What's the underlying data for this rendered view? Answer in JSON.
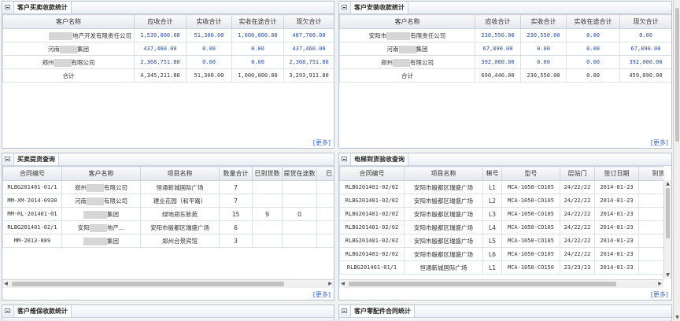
{
  "more_label": "[更多]",
  "sales_stats": {
    "title": "客户买卖收款统计",
    "headers": [
      "客户名称",
      "应收合计",
      "实收合计",
      "实收在途合计",
      "现欠合计"
    ],
    "rows": [
      {
        "name_suffix": "地产开发有限责任公司",
        "receivable": "1,539,000.00",
        "received": "51,300.00",
        "in_transit": "1,000,000.00",
        "owed": "487,700.00"
      },
      {
        "name_prefix": "河南",
        "name_suffix": "集团",
        "receivable": "437,460.00",
        "received": "0.00",
        "in_transit": "0.00",
        "owed": "437,460.00"
      },
      {
        "name_prefix": "郑州",
        "name_suffix": "有限公司",
        "receivable": "2,368,751.80",
        "received": "0.00",
        "in_transit": "0.00",
        "owed": "2,368,751.80"
      }
    ],
    "total": {
      "label": "合计",
      "receivable": "4,345,211.80",
      "received": "51,300.00",
      "in_transit": "1,000,000.00",
      "owed": "3,293,911.80"
    }
  },
  "install_stats": {
    "title": "客户安装收款统计",
    "headers": [
      "客户名称",
      "应收合计",
      "实收合计",
      "实收在途合计",
      "现欠合计"
    ],
    "rows": [
      {
        "name_prefix": "安阳市",
        "name_suffix": "有限责任公司",
        "receivable": "230,550.00",
        "received": "230,550.00",
        "in_transit": "0.00",
        "owed": "0.00"
      },
      {
        "name_prefix": "河南",
        "name_suffix": "集团",
        "receivable": "67,890.00",
        "received": "0.00",
        "in_transit": "0.00",
        "owed": "67,890.00"
      },
      {
        "name_prefix": "郑州",
        "name_suffix": "有限公司",
        "receivable": "392,000.00",
        "received": "0.00",
        "in_transit": "0.00",
        "owed": "392,000.00"
      }
    ],
    "total": {
      "label": "合计",
      "receivable": "690,440.00",
      "received": "230,550.00",
      "in_transit": "0.00",
      "owed": "459,890.00"
    }
  },
  "pickup_query": {
    "title": "买卖提货查询",
    "headers": [
      "合同编号",
      "客户名称",
      "项目名称",
      "数量合计",
      "已到货数",
      "提货在途数",
      "已"
    ],
    "rows": [
      {
        "contract": "RLBG201401-01/1",
        "cust_prefix": "郑州",
        "cust_suffix": "有限公司",
        "project": "恒通新城国际广场",
        "qty": "7",
        "arrived": "",
        "transit": ""
      },
      {
        "contract": "MM-XM-2014-0930",
        "cust_prefix": "河南",
        "cust_suffix": "有限公司",
        "project": "建业花园（和平路）",
        "qty": "7",
        "arrived": "",
        "transit": ""
      },
      {
        "contract": "MM-RL-201401-01",
        "cust_prefix": "",
        "cust_suffix": "集团",
        "project": "绿地郑东新苑",
        "qty": "15",
        "arrived": "9",
        "transit": "0"
      },
      {
        "contract": "RLBG201401-02/1",
        "cust_prefix": "安阳",
        "cust_suffix": "地产...",
        "project": "安阳市殷都区瑞盛广场",
        "qty": "6",
        "arrived": "",
        "transit": ""
      },
      {
        "contract": "MM-2013-089",
        "cust_prefix": "",
        "cust_suffix": "集团",
        "project": "郑州合景宾馆",
        "qty": "3",
        "arrived": "",
        "transit": ""
      }
    ]
  },
  "elevator_query": {
    "title": "电梯到货验收查询",
    "headers": [
      "合同编号",
      "项目名称",
      "梯号",
      "型号",
      "层站门",
      "签订日期",
      "到货"
    ],
    "rows": [
      {
        "contract": "RLBG201401-02/02",
        "project": "安阳市殷都区瑞盛广场",
        "unit": "L1",
        "model": "MCA-1050-CO105",
        "floors": "24/22/22",
        "date": "2014-01-23"
      },
      {
        "contract": "RLBG201401-02/02",
        "project": "安阳市殷都区瑞盛广场",
        "unit": "L2",
        "model": "MCA-1050-CO105",
        "floors": "24/22/22",
        "date": "2014-01-23"
      },
      {
        "contract": "RLBG201401-02/02",
        "project": "安阳市殷都区瑞盛广场",
        "unit": "L3",
        "model": "MCA-1050-CO105",
        "floors": "24/22/22",
        "date": "2014-01-23"
      },
      {
        "contract": "RLBG201401-02/02",
        "project": "安阳市殷都区瑞盛广场",
        "unit": "L4",
        "model": "MCA-1050-CO105",
        "floors": "24/22/22",
        "date": "2014-01-23"
      },
      {
        "contract": "RLBG201401-02/02",
        "project": "安阳市殷都区瑞盛广场",
        "unit": "L5",
        "model": "MCA-1050-CO105",
        "floors": "24/22/22",
        "date": "2014-01-23"
      },
      {
        "contract": "RLBG201401-02/02",
        "project": "安阳市殷都区瑞盛广场",
        "unit": "L6",
        "model": "MCA-1050-CO105",
        "floors": "24/22/22",
        "date": "2014-01-23"
      },
      {
        "contract": "RLBG201401-01/1",
        "project": "恒通新城国际广场",
        "unit": "L1",
        "model": "MCA-1050-CO150",
        "floors": "23/23/23",
        "date": "2014-01-23"
      }
    ]
  },
  "maintenance_stats": {
    "title": "客户维保收款统计"
  },
  "parts_stats": {
    "title": "客户零配件合同统计"
  },
  "colors": {
    "accent_blue": "#2a4fa8",
    "link": "#3366cc",
    "border": "#b8c4d2"
  }
}
